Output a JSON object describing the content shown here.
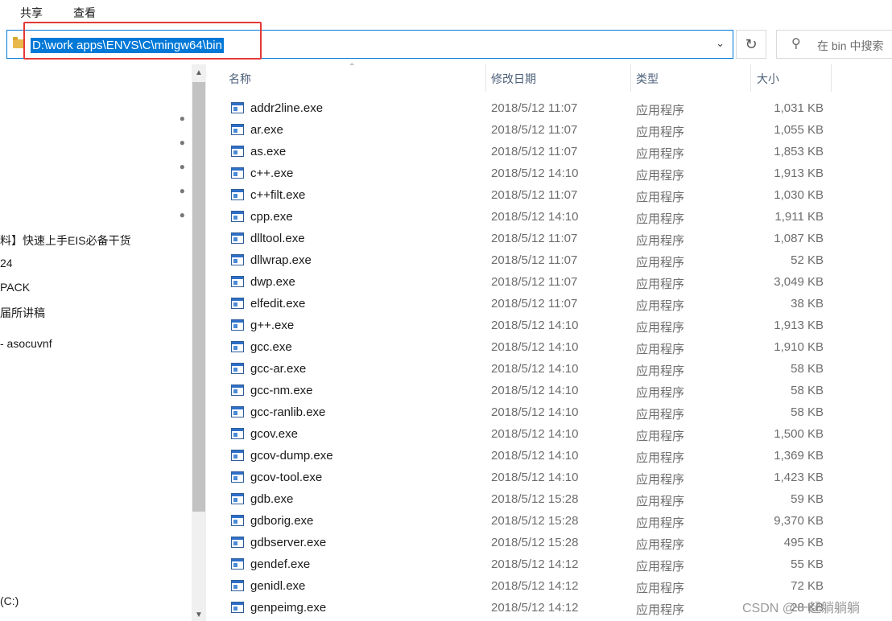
{
  "ribbon": {
    "tabs": [
      "共享",
      "查看"
    ]
  },
  "address_bar": {
    "path": "D:\\work apps\\ENVS\\C\\mingw64\\bin"
  },
  "search": {
    "placeholder": "在 bin 中搜索"
  },
  "nav_pane": {
    "items": [
      "料】快速上手EIS必备干货",
      "24",
      "PACK",
      "届所讲稿",
      "- asocuvnf",
      "(C:)"
    ]
  },
  "columns": {
    "name": "名称",
    "date": "修改日期",
    "type": "类型",
    "size": "大小"
  },
  "files": [
    {
      "name": "addr2line.exe",
      "date": "2018/5/12 11:07",
      "type": "应用程序",
      "size": "1,031 KB"
    },
    {
      "name": "ar.exe",
      "date": "2018/5/12 11:07",
      "type": "应用程序",
      "size": "1,055 KB"
    },
    {
      "name": "as.exe",
      "date": "2018/5/12 11:07",
      "type": "应用程序",
      "size": "1,853 KB"
    },
    {
      "name": "c++.exe",
      "date": "2018/5/12 14:10",
      "type": "应用程序",
      "size": "1,913 KB"
    },
    {
      "name": "c++filt.exe",
      "date": "2018/5/12 11:07",
      "type": "应用程序",
      "size": "1,030 KB"
    },
    {
      "name": "cpp.exe",
      "date": "2018/5/12 14:10",
      "type": "应用程序",
      "size": "1,911 KB"
    },
    {
      "name": "dlltool.exe",
      "date": "2018/5/12 11:07",
      "type": "应用程序",
      "size": "1,087 KB"
    },
    {
      "name": "dllwrap.exe",
      "date": "2018/5/12 11:07",
      "type": "应用程序",
      "size": "52 KB"
    },
    {
      "name": "dwp.exe",
      "date": "2018/5/12 11:07",
      "type": "应用程序",
      "size": "3,049 KB"
    },
    {
      "name": "elfedit.exe",
      "date": "2018/5/12 11:07",
      "type": "应用程序",
      "size": "38 KB"
    },
    {
      "name": "g++.exe",
      "date": "2018/5/12 14:10",
      "type": "应用程序",
      "size": "1,913 KB"
    },
    {
      "name": "gcc.exe",
      "date": "2018/5/12 14:10",
      "type": "应用程序",
      "size": "1,910 KB"
    },
    {
      "name": "gcc-ar.exe",
      "date": "2018/5/12 14:10",
      "type": "应用程序",
      "size": "58 KB"
    },
    {
      "name": "gcc-nm.exe",
      "date": "2018/5/12 14:10",
      "type": "应用程序",
      "size": "58 KB"
    },
    {
      "name": "gcc-ranlib.exe",
      "date": "2018/5/12 14:10",
      "type": "应用程序",
      "size": "58 KB"
    },
    {
      "name": "gcov.exe",
      "date": "2018/5/12 14:10",
      "type": "应用程序",
      "size": "1,500 KB"
    },
    {
      "name": "gcov-dump.exe",
      "date": "2018/5/12 14:10",
      "type": "应用程序",
      "size": "1,369 KB"
    },
    {
      "name": "gcov-tool.exe",
      "date": "2018/5/12 14:10",
      "type": "应用程序",
      "size": "1,423 KB"
    },
    {
      "name": "gdb.exe",
      "date": "2018/5/12 15:28",
      "type": "应用程序",
      "size": "59 KB"
    },
    {
      "name": "gdborig.exe",
      "date": "2018/5/12 15:28",
      "type": "应用程序",
      "size": "9,370 KB"
    },
    {
      "name": "gdbserver.exe",
      "date": "2018/5/12 15:28",
      "type": "应用程序",
      "size": "495 KB"
    },
    {
      "name": "gendef.exe",
      "date": "2018/5/12 14:12",
      "type": "应用程序",
      "size": "55 KB"
    },
    {
      "name": "genidl.exe",
      "date": "2018/5/12 14:12",
      "type": "应用程序",
      "size": "72 KB"
    },
    {
      "name": "genpeimg.exe",
      "date": "2018/5/12 14:12",
      "type": "应用程序",
      "size": "28 KB"
    }
  ],
  "watermark": "CSDN @一起躺躺躺",
  "colors": {
    "accent": "#0078d7",
    "highlight": "#e53935",
    "header_text": "#4c607a"
  }
}
